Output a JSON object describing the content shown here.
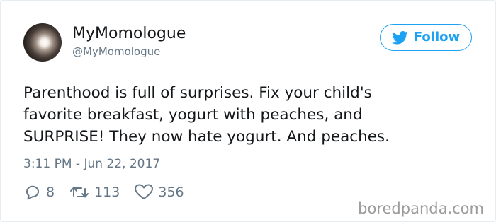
{
  "user": {
    "display_name": "MyMomologue",
    "handle": "@MyMomologue"
  },
  "follow_button": {
    "label": "Follow",
    "icon": "twitter-bird-icon"
  },
  "tweet": {
    "lines": [
      "Parenthood is full of surprises. Fix your child's",
      "favorite breakfast, yogurt with peaches, and",
      "SURPRISE! They now hate yogurt. And peaches."
    ],
    "timestamp": "3:11 PM - Jun 22, 2017"
  },
  "actions": {
    "replies": {
      "icon": "reply-icon",
      "count": "8"
    },
    "retweets": {
      "icon": "retweet-icon",
      "count": "113"
    },
    "likes": {
      "icon": "heart-icon",
      "count": "356"
    }
  },
  "watermark": "boredpanda.com",
  "colors": {
    "accent": "#1da1f2",
    "text": "#14171a",
    "muted": "#657786",
    "border": "#e6ecf0"
  }
}
